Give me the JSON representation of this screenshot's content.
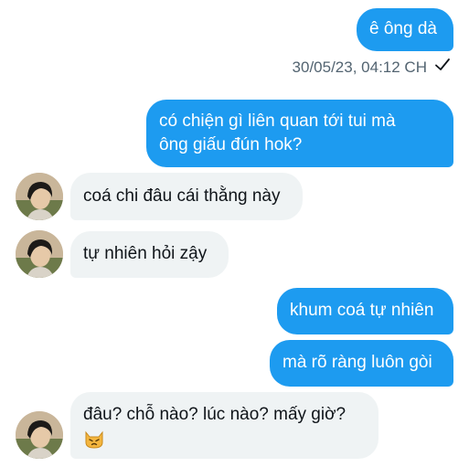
{
  "messages": [
    {
      "side": "out",
      "text": "ê ông dà"
    },
    {
      "side": "out",
      "line1": "có chiện gì liên quan tới tui mà",
      "line2": "ông giấu đún hok?"
    },
    {
      "side": "in",
      "text": "coá chi đâu cái thằng này"
    },
    {
      "side": "in",
      "text": "tự nhiên hỏi zậy"
    },
    {
      "side": "out",
      "text": "khum coá tự nhiên"
    },
    {
      "side": "out",
      "text": "mà rõ ràng luôn gòi"
    },
    {
      "side": "in",
      "text": "đâu? chỗ nào? lúc nào? mấy giờ?",
      "emoji": "cat-emoji"
    }
  ],
  "status": {
    "timestamp": "30/05/23, 04:12 CH",
    "seen_icon": "check-icon"
  },
  "colors": {
    "outgoing": "#1d9bf0",
    "incoming": "#eff3f4",
    "text_dark": "#0f1419",
    "timestamp": "#536471"
  }
}
